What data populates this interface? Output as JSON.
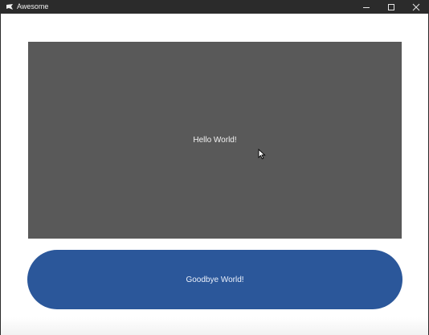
{
  "window": {
    "title": "Awesome",
    "icon": "app-logo-icon",
    "controls": [
      "minimize-icon",
      "maximize-icon",
      "close-icon"
    ]
  },
  "panel": {
    "label": "Hello World!",
    "background_color": "#595959"
  },
  "button": {
    "label": "Goodbye World!",
    "background_color": "#2b579a"
  },
  "titlebar_color": "#2b2b2b"
}
